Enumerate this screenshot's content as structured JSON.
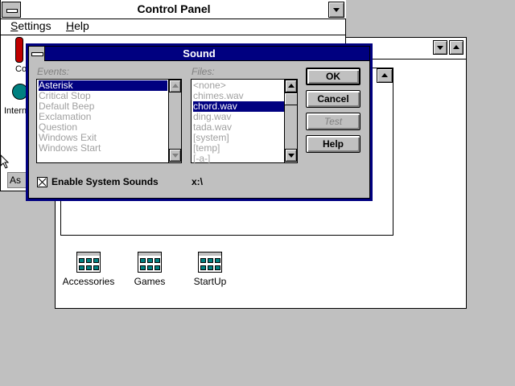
{
  "program_manager": {
    "groups": [
      {
        "label": "Accessories"
      },
      {
        "label": "Games"
      },
      {
        "label": "StartUp"
      }
    ]
  },
  "control_panel": {
    "title": "Control Panel",
    "menu": [
      "Settings",
      "Help"
    ],
    "partial_icon_labels": [
      "Co",
      "Intern"
    ],
    "status_fragment": "As"
  },
  "sound_dialog": {
    "title": "Sound",
    "events_label": "Events:",
    "events": [
      {
        "label": "Asterisk",
        "selected": true
      },
      {
        "label": "Critical Stop"
      },
      {
        "label": "Default Beep"
      },
      {
        "label": "Exclamation"
      },
      {
        "label": "Question"
      },
      {
        "label": "Windows Exit"
      },
      {
        "label": "Windows Start"
      }
    ],
    "files_label": "Files:",
    "files": [
      {
        "label": "<none>"
      },
      {
        "label": "chimes.wav"
      },
      {
        "label": "chord.wav",
        "selected": true
      },
      {
        "label": "ding.wav"
      },
      {
        "label": "tada.wav"
      },
      {
        "label": "[system]"
      },
      {
        "label": "[temp]"
      },
      {
        "label": "[-a-]"
      }
    ],
    "buttons": {
      "ok": "OK",
      "cancel": "Cancel",
      "test": "Test",
      "help": "Help"
    },
    "enable_sounds_label": "Enable System Sounds",
    "enable_sounds_checked": true,
    "current_dir": "x:\\"
  },
  "colors": {
    "desktop": "#c0c0c0",
    "title_active": "#000080",
    "selection": "#000080"
  }
}
